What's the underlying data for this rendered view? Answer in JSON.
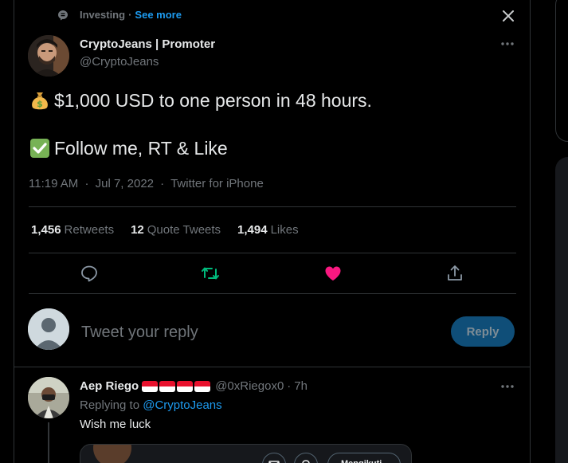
{
  "context": {
    "topic": "Investing",
    "separator": "·",
    "see_more": "See more"
  },
  "tweet": {
    "author_name": "CryptoJeans | Promoter",
    "author_handle": "@CryptoJeans",
    "line1": "$1,000 USD to one person in 48 hours.",
    "line2": "Follow me, RT & Like",
    "time": "11:19 AM",
    "date": "Jul 7, 2022",
    "source": "Twitter for iPhone",
    "dot": "·"
  },
  "stats": {
    "retweets_count": "1,456",
    "retweets_label": "Retweets",
    "quotes_count": "12",
    "quotes_label": "Quote Tweets",
    "likes_count": "1,494",
    "likes_label": "Likes"
  },
  "composer": {
    "placeholder": "Tweet your reply",
    "button_label": "Reply"
  },
  "reply": {
    "name": "Aep Riego",
    "handle": "@0xRiegox0",
    "time": "7h",
    "dot": "·",
    "replying_prefix": "Replying to",
    "mention": "@CryptoJeans",
    "text": "Wish me luck",
    "embed_follow": "Mengikuti"
  },
  "colors": {
    "background": "#000000",
    "accent": "#1d9bf0",
    "retweet_active": "#00ba7c",
    "like_active": "#f91880",
    "muted": "#71767b",
    "border": "#2f3336"
  },
  "icons": {
    "topic": "topic-icon",
    "close": "close-icon",
    "more": "more-icon",
    "money_bag": "money-bag-emoji",
    "check_mark": "check-mark-emoji",
    "reply": "reply-icon",
    "retweet": "retweet-icon",
    "like": "heart-icon",
    "share": "share-icon"
  }
}
